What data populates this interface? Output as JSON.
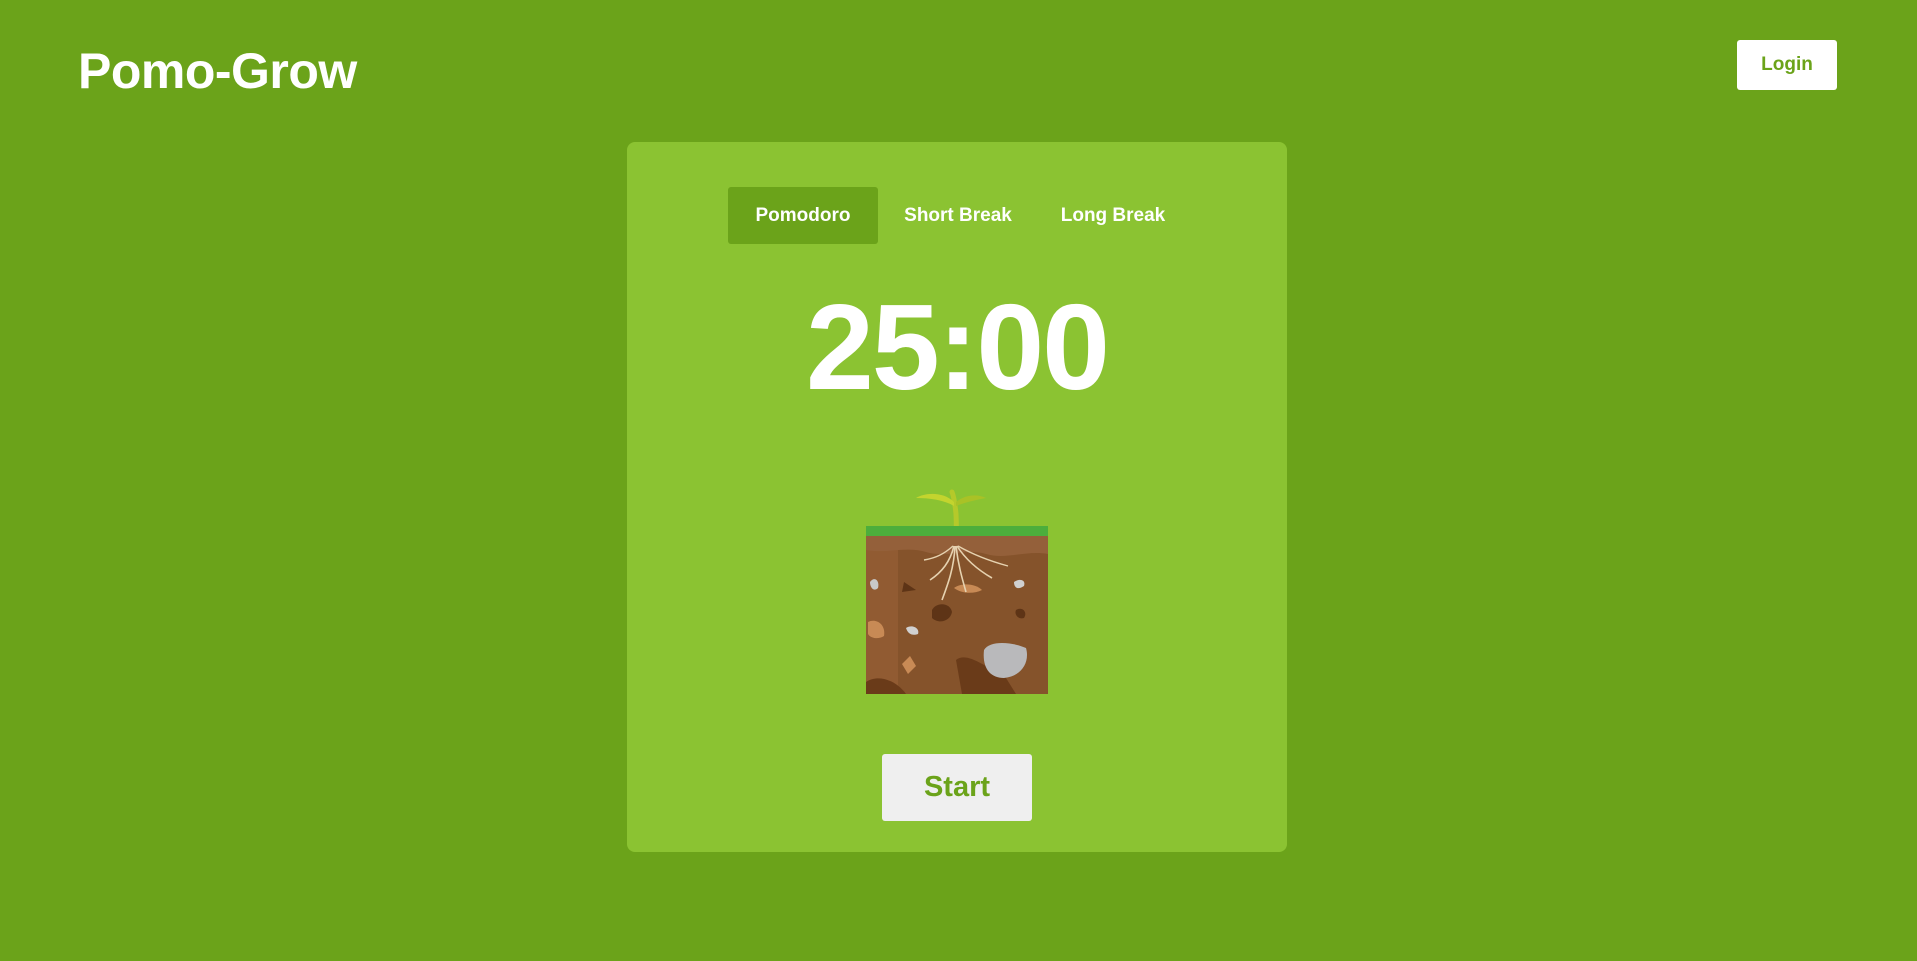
{
  "header": {
    "app_title": "Pomo-Grow",
    "login_label": "Login"
  },
  "timer_card": {
    "tabs": [
      {
        "label": "Pomodoro",
        "active": true
      },
      {
        "label": "Short Break",
        "active": false
      },
      {
        "label": "Long Break",
        "active": false
      }
    ],
    "time_display": "25:00",
    "illustration": "seedling-in-soil-icon",
    "start_label": "Start"
  },
  "colors": {
    "page_background": "#6ba31a",
    "card_background": "#8bc332",
    "active_tab": "#6ba31a",
    "button_background": "#efefef",
    "button_text": "#6ba31a",
    "grass": "#4cae3c",
    "soil": "#85532b"
  }
}
